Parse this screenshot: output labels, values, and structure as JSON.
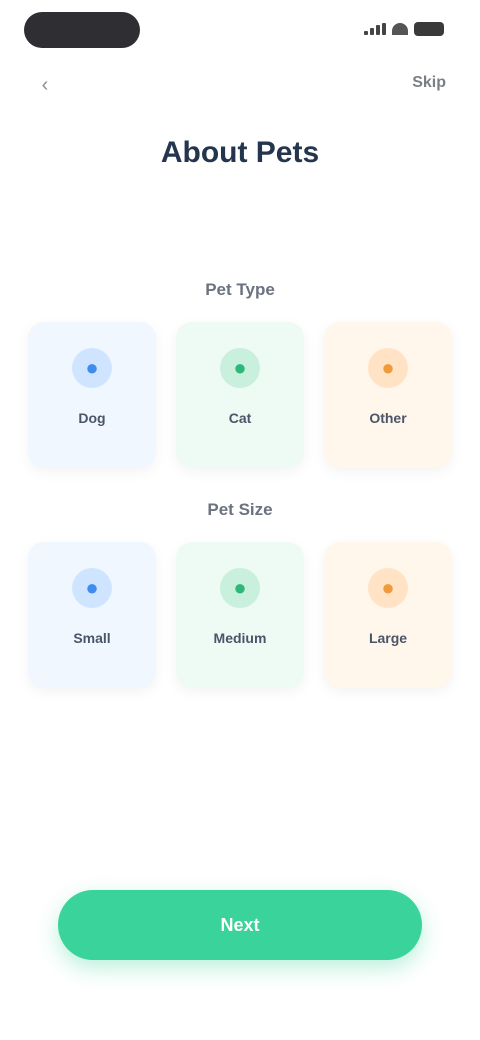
{
  "status_bar": {},
  "nav": {
    "back_icon": "chevron-left-icon",
    "skip_label": "Skip"
  },
  "header": {
    "title": "About Pets",
    "subtitle": ""
  },
  "sections": [
    {
      "label": "Pet Type",
      "cards": [
        {
          "name": "Dog",
          "desc": "",
          "icon": "dog-icon",
          "glyph": "●",
          "color": "#3f8cf0"
        },
        {
          "name": "Cat",
          "desc": "",
          "icon": "cat-icon",
          "glyph": "●",
          "color": "#2fb679"
        },
        {
          "name": "Other",
          "desc": "",
          "icon": "paw-icon",
          "glyph": "●",
          "color": "#f09a3e"
        }
      ]
    },
    {
      "label": "Pet Size",
      "cards": [
        {
          "name": "Small",
          "desc": "",
          "icon": "small-size-icon",
          "glyph": "●",
          "color": "#3f8cf0"
        },
        {
          "name": "Medium",
          "desc": "",
          "icon": "medium-size-icon",
          "glyph": "●",
          "color": "#2fb679"
        },
        {
          "name": "Large",
          "desc": "",
          "icon": "large-size-icon",
          "glyph": "●",
          "color": "#f09a3e"
        }
      ]
    }
  ],
  "footer": {
    "continue_label": "Next",
    "accent": "#3ad39b"
  }
}
